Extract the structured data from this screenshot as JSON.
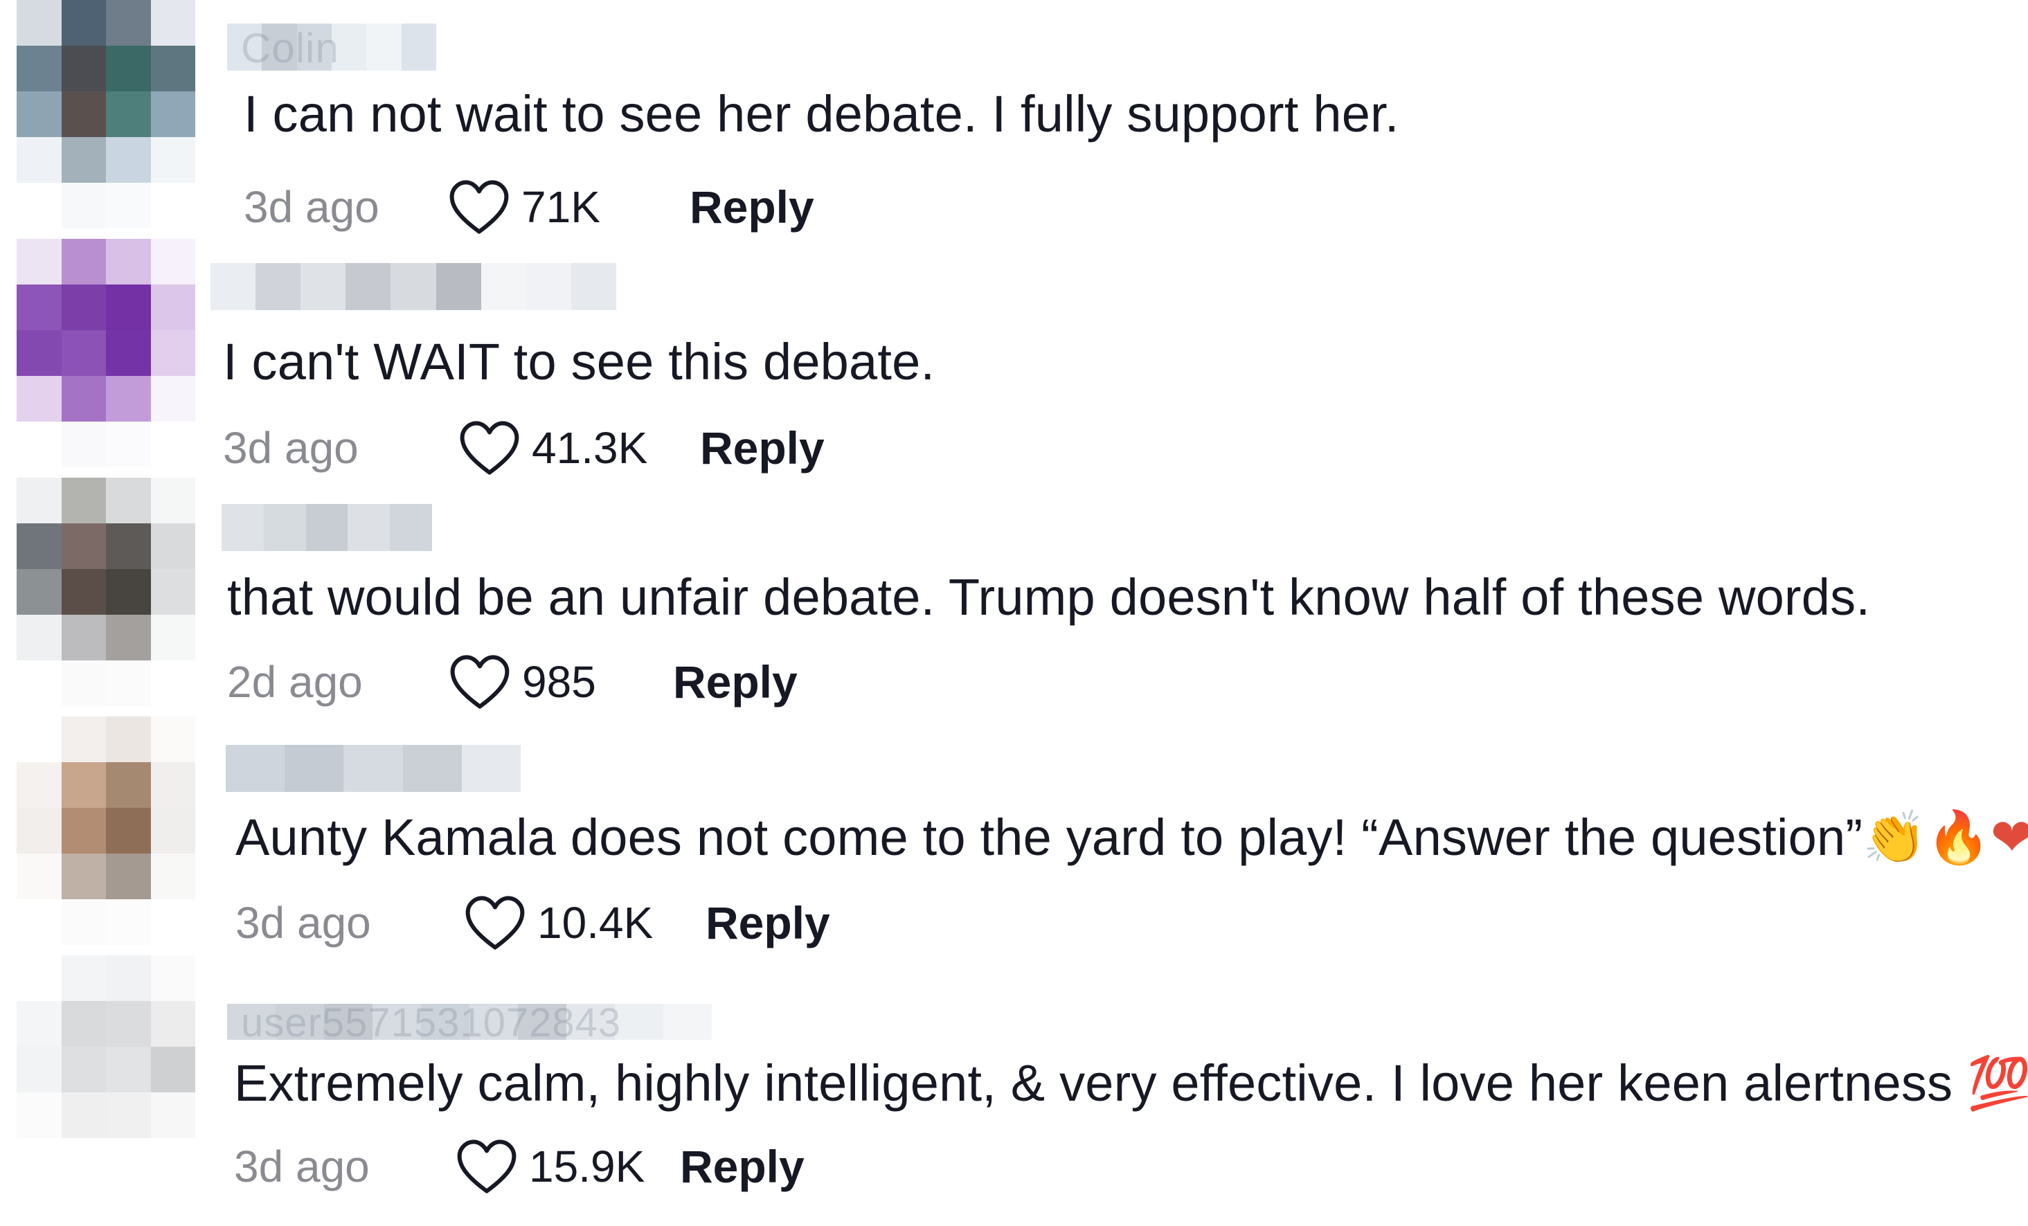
{
  "comments": [
    {
      "username": "Colin",
      "text": "I can not wait to see her debate. I fully support her.",
      "age": "3d ago",
      "likes": "71K",
      "reply_label": "Reply"
    },
    {
      "username": "",
      "text": "I can't WAIT to see this debate.",
      "age": "3d ago",
      "likes": "41.3K",
      "reply_label": "Reply"
    },
    {
      "username": "",
      "text": "that would be an unfair debate. Trump doesn't know half of these words.",
      "age": "2d ago",
      "likes": "985",
      "reply_label": "Reply"
    },
    {
      "username": "",
      "text": "Aunty Kamala does not come to the yard to play! “Answer the question”",
      "emojis": "👏🔥❤",
      "age": "3d ago",
      "likes": "10.4K",
      "reply_label": "Reply"
    },
    {
      "username": "user5571531072843",
      "text": "Extremely calm, highly intelligent, & very effective. I love her keen alertness",
      "emojis": "💯",
      "age": "3d ago",
      "likes": "15.9K",
      "reply_label": "Reply"
    }
  ],
  "icons": {
    "like": "heart-outline-icon"
  },
  "colors": {
    "text": "#161823",
    "muted": "#8a8b91",
    "background": "#ffffff"
  }
}
